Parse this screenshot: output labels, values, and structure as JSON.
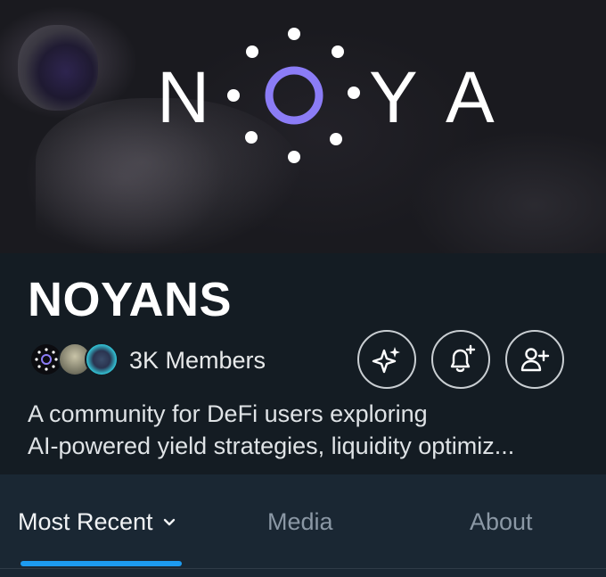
{
  "banner": {
    "logo_text": "N O Y A",
    "logo_accent_color": "#8b7cf6"
  },
  "community": {
    "name": "NOYANS",
    "members_label": "3K Members",
    "description_line1": "A community for DeFi users exploring",
    "description_line2": "AI-powered yield strategies, liquidity optimiz..."
  },
  "actions": {
    "icons": [
      "sparkle-icon",
      "bell-plus-icon",
      "user-plus-icon"
    ]
  },
  "tabs": [
    {
      "label": "Most Recent",
      "active": true
    },
    {
      "label": "Media",
      "active": false
    },
    {
      "label": "About",
      "active": false
    }
  ],
  "colors": {
    "accent": "#1d9bf0",
    "background": "#15202b"
  }
}
